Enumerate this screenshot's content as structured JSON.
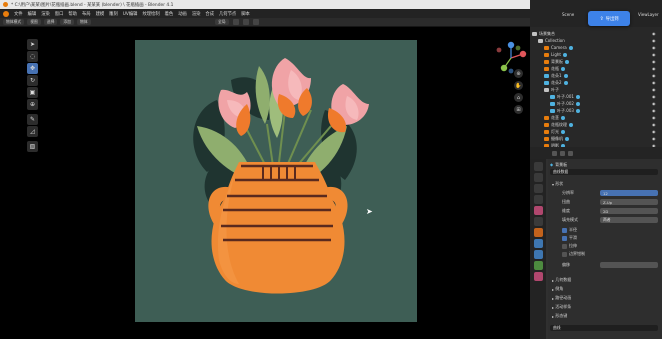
{
  "window": {
    "title": "* C:\\用户\\某某\\图片\\花瓶插画.blend - 某某某 (blender) \\ 花瓶插画 - Blender 4.1",
    "accent_color": "#e87d0d"
  },
  "menu": [
    "文件",
    "编辑",
    "渲染",
    "窗口",
    "帮助",
    "布局",
    "建模",
    "雕刻",
    "UV编辑",
    "纹理绘制",
    "着色",
    "动画",
    "渲染",
    "合成",
    "几何节点",
    "脚本"
  ],
  "tool_header": {
    "mode": "物体模式",
    "view": "视图",
    "select": "选择",
    "add": "添加",
    "object": "物体",
    "transform": "全局"
  },
  "toolbar": {
    "tools": [
      "cursor-select",
      "tweak",
      "move",
      "rotate",
      "scale",
      "transform",
      "annotate",
      "measure",
      "add-cube"
    ]
  },
  "viewport": {
    "bg_color": "#3e5e55",
    "vase_color": "#f08a34",
    "stripe_color": "#5a2a1e",
    "leaf_dark": "#243a36",
    "leaf_light": "#8fae6e",
    "petal_pink": "#f0a3a6",
    "petal_orange": "#ef7a2c"
  },
  "gizmo": {
    "x": "X",
    "y": "Y",
    "z": "Z"
  },
  "header_right": {
    "scene_label": "Scene",
    "view_layer": "ViewLayer",
    "export_button": "导出到"
  },
  "outliner": {
    "rows": [
      {
        "label": "场景集合",
        "type": "coll"
      },
      {
        "label": "Collection",
        "type": "coll"
      },
      {
        "label": "Camera",
        "type": "obj"
      },
      {
        "label": "Light",
        "type": "obj"
      },
      {
        "label": "背景板",
        "type": "obj"
      },
      {
        "label": "花瓶",
        "type": "obj"
      },
      {
        "label": "花朵1",
        "type": "curve"
      },
      {
        "label": "花朵2",
        "type": "curve"
      },
      {
        "label": "叶子",
        "type": "coll"
      },
      {
        "label": "叶子.001",
        "type": "curve"
      },
      {
        "label": "叶子.002",
        "type": "curve"
      },
      {
        "label": "叶子.003",
        "type": "curve"
      },
      {
        "label": "花茎",
        "type": "obj"
      },
      {
        "label": "花瓶纹理",
        "type": "obj"
      },
      {
        "label": "灯光",
        "type": "obj"
      },
      {
        "label": "摄像机",
        "type": "obj"
      },
      {
        "label": "阴影",
        "type": "obj"
      }
    ]
  },
  "properties": {
    "object_name": "背景板",
    "section_title": "曲线数据",
    "fields": {
      "shape_label": "形状",
      "resolution_label": "分辨率",
      "resolution_value": "12",
      "twist_label": "扭曲",
      "twist_value": "Z-Up",
      "dim_label": "维度",
      "dim_value": "2D",
      "fill_label": "填充模式",
      "fill_value": "两者",
      "radius_label": "半径",
      "smooth_label": "平滑",
      "stretch_label": "拉伸",
      "bounds_label": "边界钳制",
      "offset_label": "偏移",
      "geometry_label": "几何数据",
      "bevel_label": "倒角",
      "path_label": "路径动画",
      "active_spline_label": "活动样条",
      "shape_keys_label": "形态键",
      "custom_label": "自定义属性"
    },
    "footer_field": "曲线"
  }
}
